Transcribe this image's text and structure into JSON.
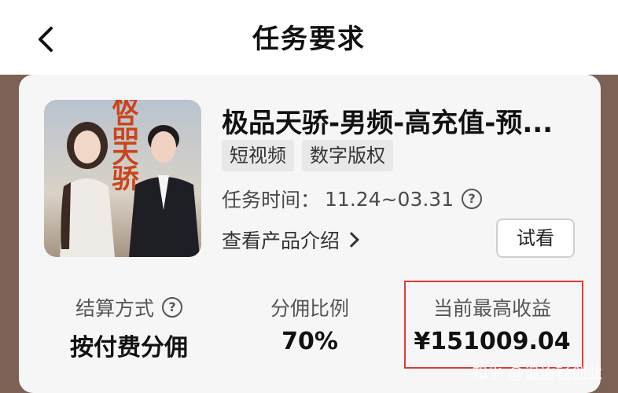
{
  "header": {
    "title": "任务要求"
  },
  "product": {
    "title": "极品天骄-男频-高充值-预...",
    "tags": [
      "短视频",
      "数字版权"
    ],
    "task_time_label": "任务时间：",
    "task_time_value": "11.24~03.31",
    "view_intro_label": "查看产品介绍",
    "try_watch_label": "试看",
    "poster_text": "极品天骄"
  },
  "stats": {
    "settlement_label": "结算方式",
    "settlement_value": "按付费分佣",
    "commission_label": "分佣比例",
    "commission_value": "70%",
    "earnings_label": "当前最高收益",
    "earnings_value": "¥151009.04"
  },
  "watermark": "知乎 @追逐轻创业",
  "colors": {
    "highlight": "#e53935",
    "background": "#7d6155",
    "card": "#f7f6f6"
  }
}
